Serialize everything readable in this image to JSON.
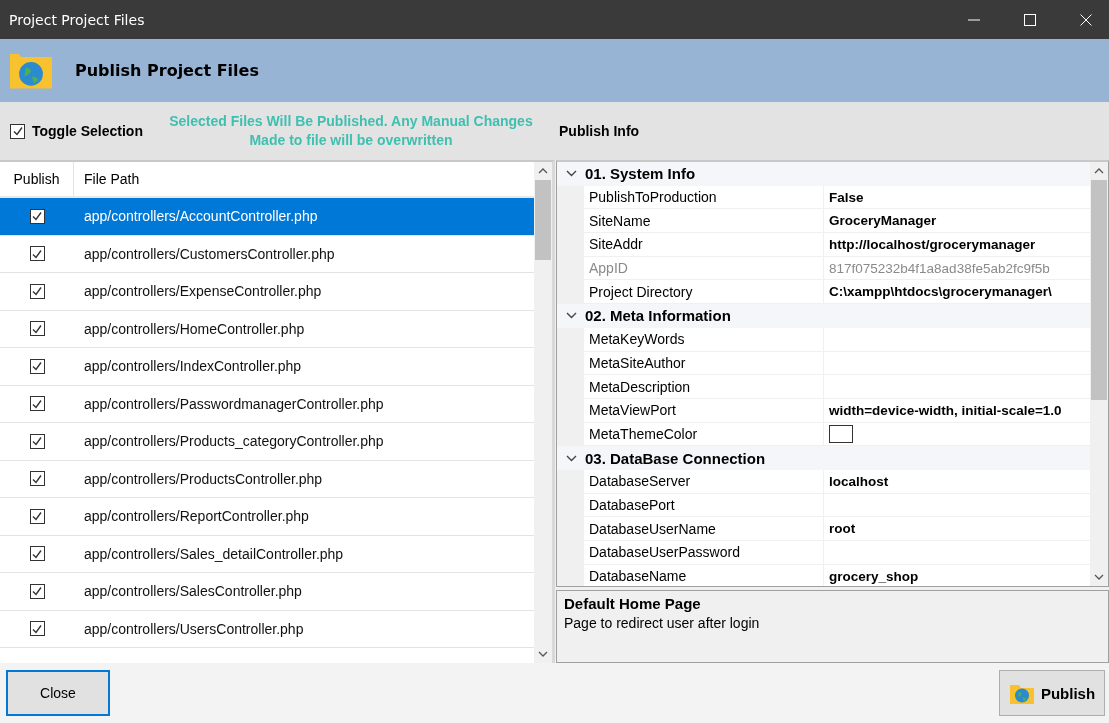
{
  "window": {
    "title": "Project Project Files"
  },
  "header": {
    "title": "Publish Project Files"
  },
  "toggle": {
    "label": "Toggle Selection",
    "checked": true
  },
  "notice": "Selected Files Will Be Published. Any Manual Changes Made to file will be overwritten",
  "files": {
    "columns": [
      "Publish",
      "File Path"
    ],
    "rows": [
      {
        "path": "app/controllers/AccountController.php",
        "checked": true,
        "selected": true
      },
      {
        "path": "app/controllers/CustomersController.php",
        "checked": true,
        "selected": false
      },
      {
        "path": "app/controllers/ExpenseController.php",
        "checked": true,
        "selected": false
      },
      {
        "path": "app/controllers/HomeController.php",
        "checked": true,
        "selected": false
      },
      {
        "path": "app/controllers/IndexController.php",
        "checked": true,
        "selected": false
      },
      {
        "path": "app/controllers/PasswordmanagerController.php",
        "checked": true,
        "selected": false
      },
      {
        "path": "app/controllers/Products_categoryController.php",
        "checked": true,
        "selected": false
      },
      {
        "path": "app/controllers/ProductsController.php",
        "checked": true,
        "selected": false
      },
      {
        "path": "app/controllers/ReportController.php",
        "checked": true,
        "selected": false
      },
      {
        "path": "app/controllers/Sales_detailController.php",
        "checked": true,
        "selected": false
      },
      {
        "path": "app/controllers/SalesController.php",
        "checked": true,
        "selected": false
      },
      {
        "path": "app/controllers/UsersController.php",
        "checked": true,
        "selected": false
      }
    ]
  },
  "publish_info": {
    "title": "Publish Info",
    "categories": [
      {
        "name": "01. System Info",
        "expanded": true,
        "properties": [
          {
            "name": "PublishToProduction",
            "value": "False",
            "disabled": false
          },
          {
            "name": "SiteName",
            "value": "GroceryManager",
            "disabled": false
          },
          {
            "name": "SiteAddr",
            "value": "http://localhost/grocerymanager",
            "disabled": false
          },
          {
            "name": "AppID",
            "value": "817f075232b4f1a8ad38fe5ab2fc9f5b",
            "disabled": true
          },
          {
            "name": "Project Directory",
            "value": "C:\\xampp\\htdocs\\grocerymanager\\",
            "disabled": false
          }
        ]
      },
      {
        "name": "02. Meta Information",
        "expanded": true,
        "properties": [
          {
            "name": "MetaKeyWords",
            "disabled": false
          },
          {
            "name": "MetaSiteAuthor",
            "disabled": false
          },
          {
            "name": "MetaDescription",
            "disabled": false
          },
          {
            "name": "MetaViewPort",
            "value": "width=device-width, initial-scale=1.0",
            "disabled": false
          },
          {
            "name": "MetaThemeColor",
            "kind": "color",
            "color": "#ffffff",
            "disabled": false
          }
        ]
      },
      {
        "name": "03. DataBase Connection",
        "expanded": true,
        "properties": [
          {
            "name": "DatabaseServer",
            "value": "localhost",
            "disabled": false
          },
          {
            "name": "DatabasePort",
            "disabled": false
          },
          {
            "name": "DatabaseUserName",
            "value": "root",
            "disabled": false
          },
          {
            "name": "DatabaseUserPassword",
            "disabled": false
          },
          {
            "name": "DatabaseName",
            "value": "grocery_shop",
            "disabled": false
          }
        ]
      }
    ]
  },
  "description": {
    "title": "Default Home Page",
    "text": "Page to redirect user after login"
  },
  "buttons": {
    "close": {
      "label": "Close",
      "focused": true
    },
    "publish": {
      "label": "Publish"
    }
  }
}
